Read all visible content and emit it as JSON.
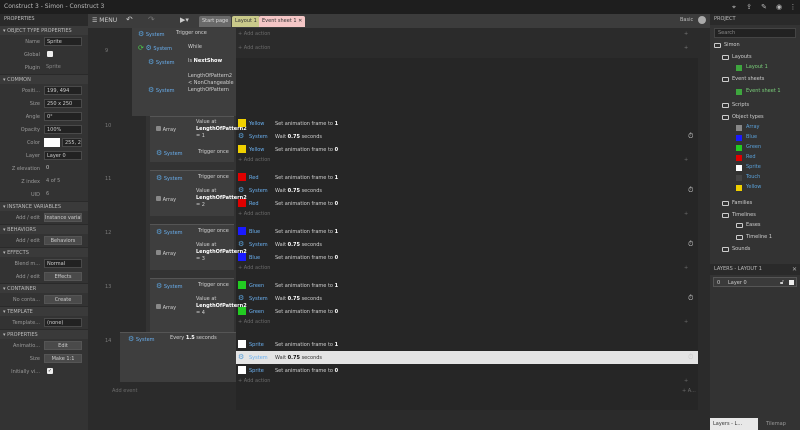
{
  "app": {
    "title": "Construct 3 - Simon - Construct 3"
  },
  "left_panel": {
    "header": "PROPERTIES",
    "sections": {
      "object_type": "OBJECT TYPE PROPERTIES",
      "common": "COMMON",
      "instance_vars": "INSTANCE VARIABLES",
      "behaviors": "BEHAVIORS",
      "effects": "EFFECTS",
      "container": "CONTAINER",
      "template": "TEMPLATE",
      "properties": "PROPERTIES"
    },
    "rows": {
      "name": {
        "label": "Name",
        "value": "Sprite"
      },
      "global": {
        "label": "Global"
      },
      "plugin": {
        "label": "Plugin",
        "value": "Sprite"
      },
      "position": {
        "label": "Positi...",
        "value": "199, 494"
      },
      "size": {
        "label": "Size",
        "value": "250 x 250"
      },
      "angle": {
        "label": "Angle",
        "value": "0°"
      },
      "opacity": {
        "label": "Opacity",
        "value": "100%"
      },
      "color": {
        "label": "Color",
        "value": "255, 2"
      },
      "layer": {
        "label": "Layer",
        "value": "Layer 0"
      },
      "zelev": {
        "label": "Z elevation",
        "value": "0"
      },
      "zindex": {
        "label": "Z index",
        "value": "4 of 5"
      },
      "uid": {
        "label": "UID",
        "value": "6"
      },
      "inst_edit": {
        "label": "Add / edit",
        "value": "Instance variable"
      },
      "beh_edit": {
        "label": "Add / edit",
        "value": "Behaviors"
      },
      "blend": {
        "label": "Blend m...",
        "value": "Normal"
      },
      "eff_edit": {
        "label": "Add / edit",
        "value": "Effects"
      },
      "cont": {
        "label": "No conta...",
        "value": "Create"
      },
      "templ": {
        "label": "Template...",
        "value": "(none)"
      },
      "anim": {
        "label": "Animatio...",
        "value": "Edit"
      },
      "size2": {
        "label": "Size",
        "value": "Make 1:1"
      },
      "initial": {
        "label": "Initially vi...",
        "value": "✓"
      }
    }
  },
  "menubar": {
    "menu": "MENU",
    "tabs": [
      "Start page",
      "Layout 1",
      "Event sheet 1"
    ],
    "basic": "Basic"
  },
  "events": {
    "e9": {
      "num": "9",
      "trigger": "Trigger once",
      "while": "While",
      "is_next": "Is ",
      "is_next_b": "NextShow",
      "length_cond": "LengthOfPattern2 < NonChangeableLengthOfPattern",
      "sys": "System",
      "add_action": "Add action"
    },
    "e10": {
      "num": "10",
      "value_at": "Value at ",
      "value_at_b": "LengthOfPattern2",
      "eq": " = 1",
      "array": "Array",
      "trigger": "Trigger once"
    },
    "e11": {
      "num": "11",
      "trigger": "Trigger once",
      "eq": " = 2"
    },
    "e12": {
      "num": "12",
      "eq": " = 3"
    },
    "e13": {
      "num": "13",
      "eq": " = 4"
    },
    "e14": {
      "num": "14",
      "every": "Every ",
      "every_b": "1.5",
      "seconds": " seconds"
    },
    "actions": {
      "set_anim": "Set animation frame to ",
      "wait": "Wait ",
      "wait_b": "0.75",
      "wait_s": " seconds",
      "yellow": "Yellow",
      "red": "Red",
      "blue": "Blue",
      "green": "Green",
      "sprite": "Sprite",
      "system": "System",
      "one": "1",
      "zero": "0"
    },
    "add_event": "Add event"
  },
  "project": {
    "header": "PROJECT",
    "search": "Search",
    "items": {
      "simon": "Simon",
      "layouts": "Layouts",
      "layout1": "Layout 1",
      "eventsheets": "Event sheets",
      "es1": "Event sheet 1",
      "scripts": "Scripts",
      "objtypes": "Object types",
      "array": "Array",
      "blue": "Blue",
      "green": "Green",
      "red": "Red",
      "sprite": "Sprite",
      "touch": "Touch",
      "yellow": "Yellow",
      "families": "Families",
      "timelines": "Timelines",
      "eases": "Eases",
      "timeline1": "Timeline 1",
      "sounds": "Sounds"
    }
  },
  "layers": {
    "header": "LAYERS - LAYOUT 1",
    "row_num": "0",
    "row_name": "Layer 0",
    "tab1": "Layers - L...",
    "tab2": "Tilemap"
  },
  "colors": {
    "yellow": "#f0d000",
    "red": "#e00000",
    "blue": "#1a1aff",
    "green": "#22cc22",
    "sprite": "#ffffff",
    "accent": "#5aa0d8"
  }
}
